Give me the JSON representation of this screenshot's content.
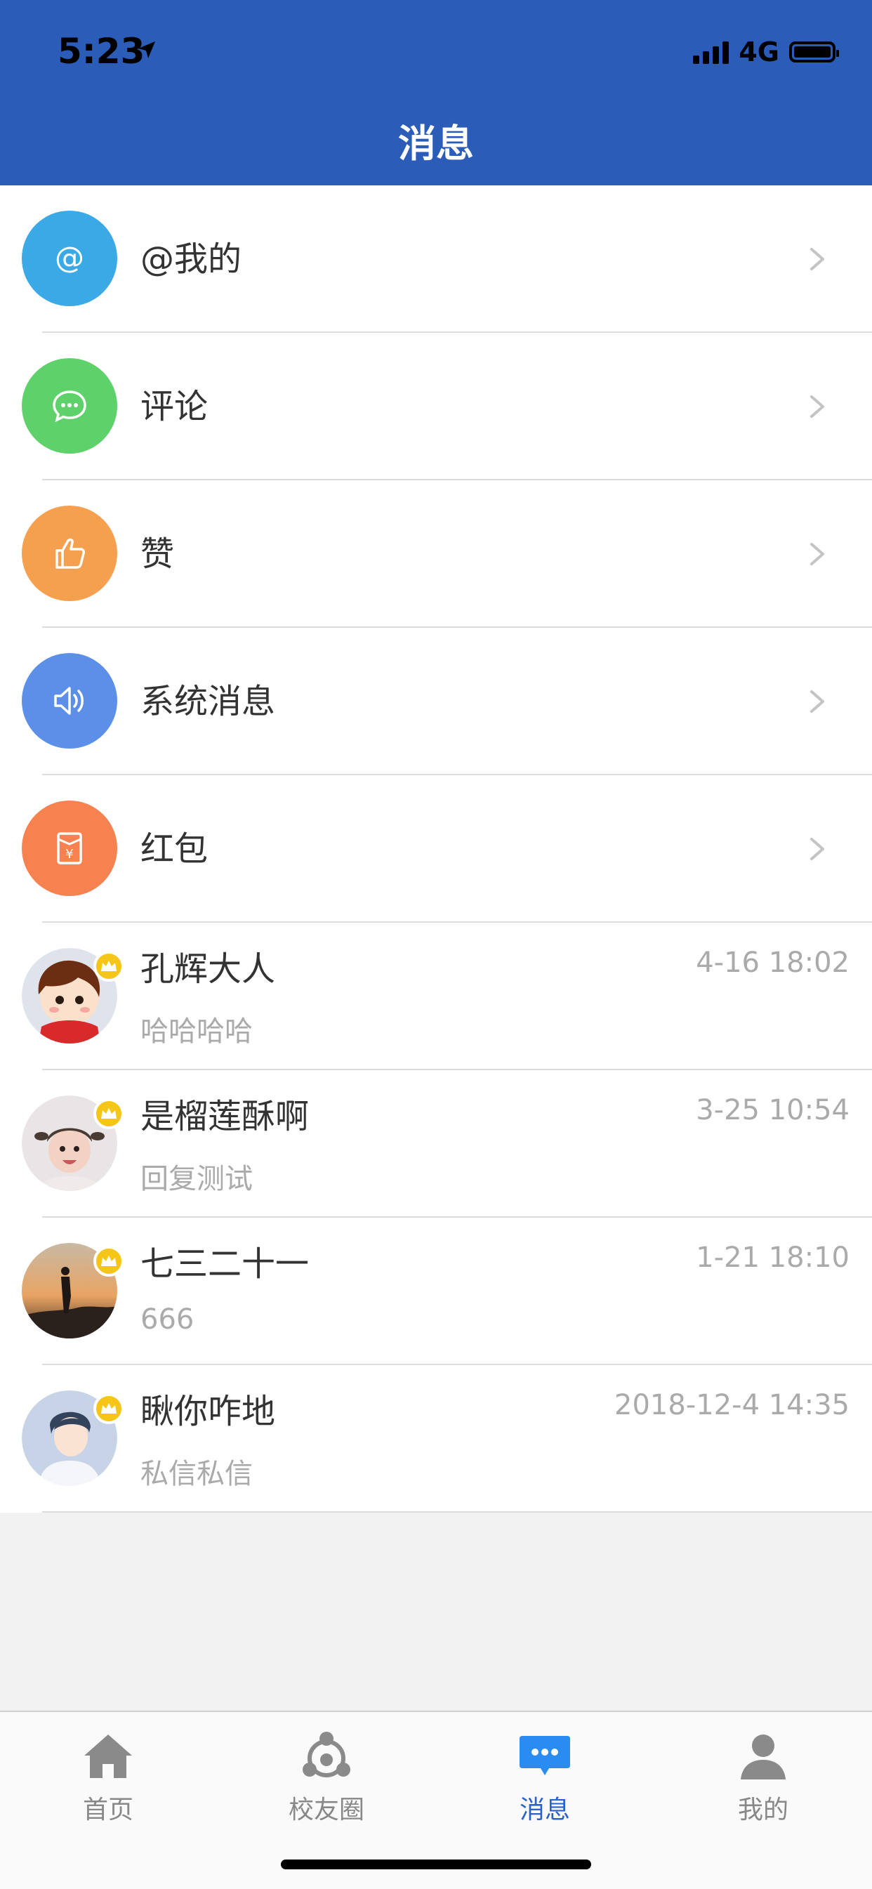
{
  "status_bar": {
    "time": "5:23",
    "network": "4G"
  },
  "header": {
    "title": "消息"
  },
  "menu": [
    {
      "label": "@我的",
      "icon": "at-icon",
      "color": "#3aa9e6"
    },
    {
      "label": "评论",
      "icon": "comment-icon",
      "color": "#5fd16a"
    },
    {
      "label": "赞",
      "icon": "thumbs-up-icon",
      "color": "#f5a04f"
    },
    {
      "label": "系统消息",
      "icon": "speaker-icon",
      "color": "#5b8fe8"
    },
    {
      "label": "红包",
      "icon": "red-envelope-icon",
      "color": "#f5824f"
    }
  ],
  "messages": [
    {
      "name": "孔辉大人",
      "preview": "哈哈哈哈",
      "time": "4-16 18:02"
    },
    {
      "name": "是榴莲酥啊",
      "preview": "回复测试",
      "time": "3-25 10:54"
    },
    {
      "name": "七三二十一",
      "preview": "666",
      "time": "1-21 18:10"
    },
    {
      "name": "瞅你咋地",
      "preview": "私信私信",
      "time": "2018-12-4 14:35"
    }
  ],
  "tabs": [
    {
      "label": "首页",
      "icon": "home-icon"
    },
    {
      "label": "校友圈",
      "icon": "alumni-circle-icon"
    },
    {
      "label": "消息",
      "icon": "message-icon",
      "active": true
    },
    {
      "label": "我的",
      "icon": "profile-icon"
    }
  ],
  "colors": {
    "header": "#2a5cb8",
    "active_tab": "#2a62c9"
  }
}
